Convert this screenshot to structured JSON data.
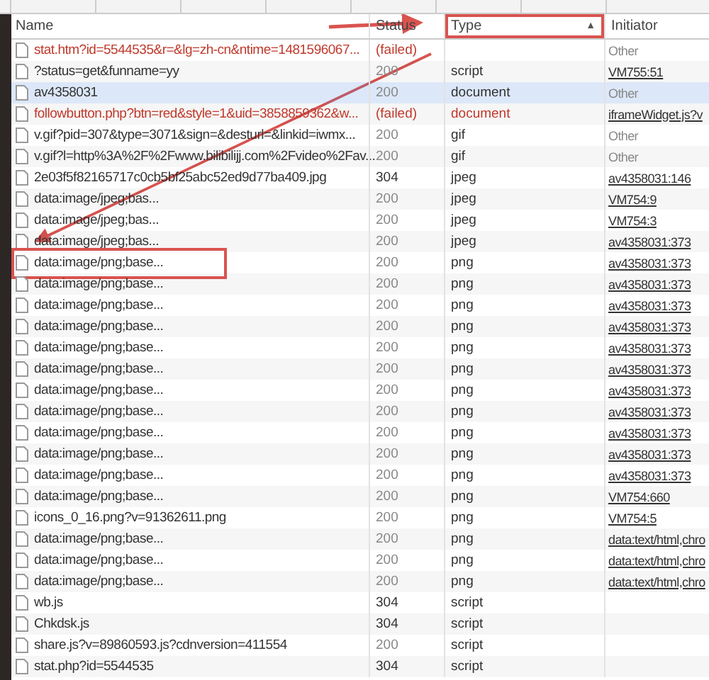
{
  "columns": [
    {
      "label": "Name",
      "marked": false
    },
    {
      "label": "Status",
      "marked": false
    },
    {
      "label": "Type",
      "marked": true,
      "sort_indicator": "▲"
    },
    {
      "label": "Initiator",
      "marked": false
    }
  ],
  "rows": [
    {
      "name": "stat.htm?id=5544535&r=&lg=zh-cn&ntime=1481596067...",
      "status": "(failed)",
      "initiator": {
        "text": "Other",
        "link": false
      },
      "failed": true,
      "selected": false,
      "marked": false
    },
    {
      "name": "?status=get&funname=yy",
      "status": "200",
      "type": "script",
      "initiator": {
        "text": "VM755:51",
        "link": true
      },
      "failed": false,
      "selected": false,
      "marked": false
    },
    {
      "name": "av4358031",
      "status": "200",
      "type": "document",
      "initiator": {
        "text": "Other",
        "link": false
      },
      "failed": false,
      "selected": true,
      "marked": false
    },
    {
      "name": "followbutton.php?btn=red&style=1&uid=3858859362&w...",
      "status": "(failed)",
      "type": "document",
      "initiator": {
        "text": "iframeWidget.js?v",
        "link": true
      },
      "failed": true,
      "selected": false,
      "marked": false
    },
    {
      "name": "v.gif?pid=307&type=3071&sign=&desturl=&linkid=iwmx...",
      "status": "200",
      "type": "gif",
      "initiator": {
        "text": "Other",
        "link": false
      },
      "failed": false,
      "selected": false,
      "marked": false
    },
    {
      "name": "v.gif?l=http%3A%2F%2Fwww.bilibilijj.com%2Fvideo%2Fav...",
      "status": "200",
      "type": "gif",
      "initiator": {
        "text": "Other",
        "link": false
      },
      "failed": false,
      "selected": false,
      "marked": false
    },
    {
      "name": "2e03f5f82165717c0cb5bf25abc52ed9d77ba409.jpg",
      "status": "304",
      "type": "jpeg",
      "initiator": {
        "text": "av4358031:146",
        "link": true
      },
      "failed": false,
      "selected": false,
      "marked": false
    },
    {
      "name": "data:image/jpeg;bas...",
      "status": "200",
      "type": "jpeg",
      "initiator": {
        "text": "VM754:9",
        "link": true
      },
      "failed": false,
      "selected": false,
      "marked": false
    },
    {
      "name": "data:image/jpeg;bas...",
      "status": "200",
      "type": "jpeg",
      "initiator": {
        "text": "VM754:3",
        "link": true
      },
      "failed": false,
      "selected": false,
      "marked": false
    },
    {
      "name": "data:image/jpeg;bas...",
      "status": "200",
      "type": "jpeg",
      "initiator": {
        "text": "av4358031:373",
        "link": true
      },
      "failed": false,
      "selected": false,
      "marked": false
    },
    {
      "name": "data:image/png;base...",
      "status": "200",
      "type": "png",
      "initiator": {
        "text": "av4358031:373",
        "link": true
      },
      "failed": false,
      "selected": false,
      "marked": true
    },
    {
      "name": "data:image/png;base...",
      "status": "200",
      "type": "png",
      "initiator": {
        "text": "av4358031:373",
        "link": true
      },
      "failed": false,
      "selected": false,
      "marked": false
    },
    {
      "name": "data:image/png;base...",
      "status": "200",
      "type": "png",
      "initiator": {
        "text": "av4358031:373",
        "link": true
      },
      "failed": false,
      "selected": false,
      "marked": false
    },
    {
      "name": "data:image/png;base...",
      "status": "200",
      "type": "png",
      "initiator": {
        "text": "av4358031:373",
        "link": true
      },
      "failed": false,
      "selected": false,
      "marked": false
    },
    {
      "name": "data:image/png;base...",
      "status": "200",
      "type": "png",
      "initiator": {
        "text": "av4358031:373",
        "link": true
      },
      "failed": false,
      "selected": false,
      "marked": false
    },
    {
      "name": "data:image/png;base...",
      "status": "200",
      "type": "png",
      "initiator": {
        "text": "av4358031:373",
        "link": true
      },
      "failed": false,
      "selected": false,
      "marked": false
    },
    {
      "name": "data:image/png;base...",
      "status": "200",
      "type": "png",
      "initiator": {
        "text": "av4358031:373",
        "link": true
      },
      "failed": false,
      "selected": false,
      "marked": false
    },
    {
      "name": "data:image/png;base...",
      "status": "200",
      "type": "png",
      "initiator": {
        "text": "av4358031:373",
        "link": true
      },
      "failed": false,
      "selected": false,
      "marked": false
    },
    {
      "name": "data:image/png;base...",
      "status": "200",
      "type": "png",
      "initiator": {
        "text": "av4358031:373",
        "link": true
      },
      "failed": false,
      "selected": false,
      "marked": false
    },
    {
      "name": "data:image/png;base...",
      "status": "200",
      "type": "png",
      "initiator": {
        "text": "av4358031:373",
        "link": true
      },
      "failed": false,
      "selected": false,
      "marked": false
    },
    {
      "name": "data:image/png;base...",
      "status": "200",
      "type": "png",
      "initiator": {
        "text": "av4358031:373",
        "link": true
      },
      "failed": false,
      "selected": false,
      "marked": false
    },
    {
      "name": "data:image/png;base...",
      "status": "200",
      "type": "png",
      "initiator": {
        "text": "VM754:660",
        "link": true
      },
      "failed": false,
      "selected": false,
      "marked": false
    },
    {
      "name": "icons_0_16.png?v=91362611.png",
      "status": "200",
      "type": "png",
      "initiator": {
        "text": "VM754:5",
        "link": true
      },
      "failed": false,
      "selected": false,
      "marked": false
    },
    {
      "name": "data:image/png;base...",
      "status": "200",
      "type": "png",
      "initiator": {
        "text": "data:text/html,chro",
        "link": true
      },
      "failed": false,
      "selected": false,
      "marked": false
    },
    {
      "name": "data:image/png;base...",
      "status": "200",
      "type": "png",
      "initiator": {
        "text": "data:text/html,chro",
        "link": true
      },
      "failed": false,
      "selected": false,
      "marked": false
    },
    {
      "name": "data:image/png;base...",
      "status": "200",
      "type": "png",
      "initiator": {
        "text": "data:text/html,chro",
        "link": true
      },
      "failed": false,
      "selected": false,
      "marked": false
    },
    {
      "name": "wb.js",
      "status": "304",
      "type": "script",
      "failed": false,
      "selected": false,
      "marked": false
    },
    {
      "name": "Chkdsk.js",
      "status": "304",
      "type": "script",
      "failed": false,
      "selected": false,
      "marked": false
    },
    {
      "name": "share.js?v=89860593.js?cdnversion=411554",
      "status": "200",
      "type": "script",
      "failed": false,
      "selected": false,
      "marked": false
    },
    {
      "name": "stat.php?id=5544535",
      "status": "304",
      "type": "script",
      "failed": false,
      "selected": false,
      "marked": false
    }
  ]
}
